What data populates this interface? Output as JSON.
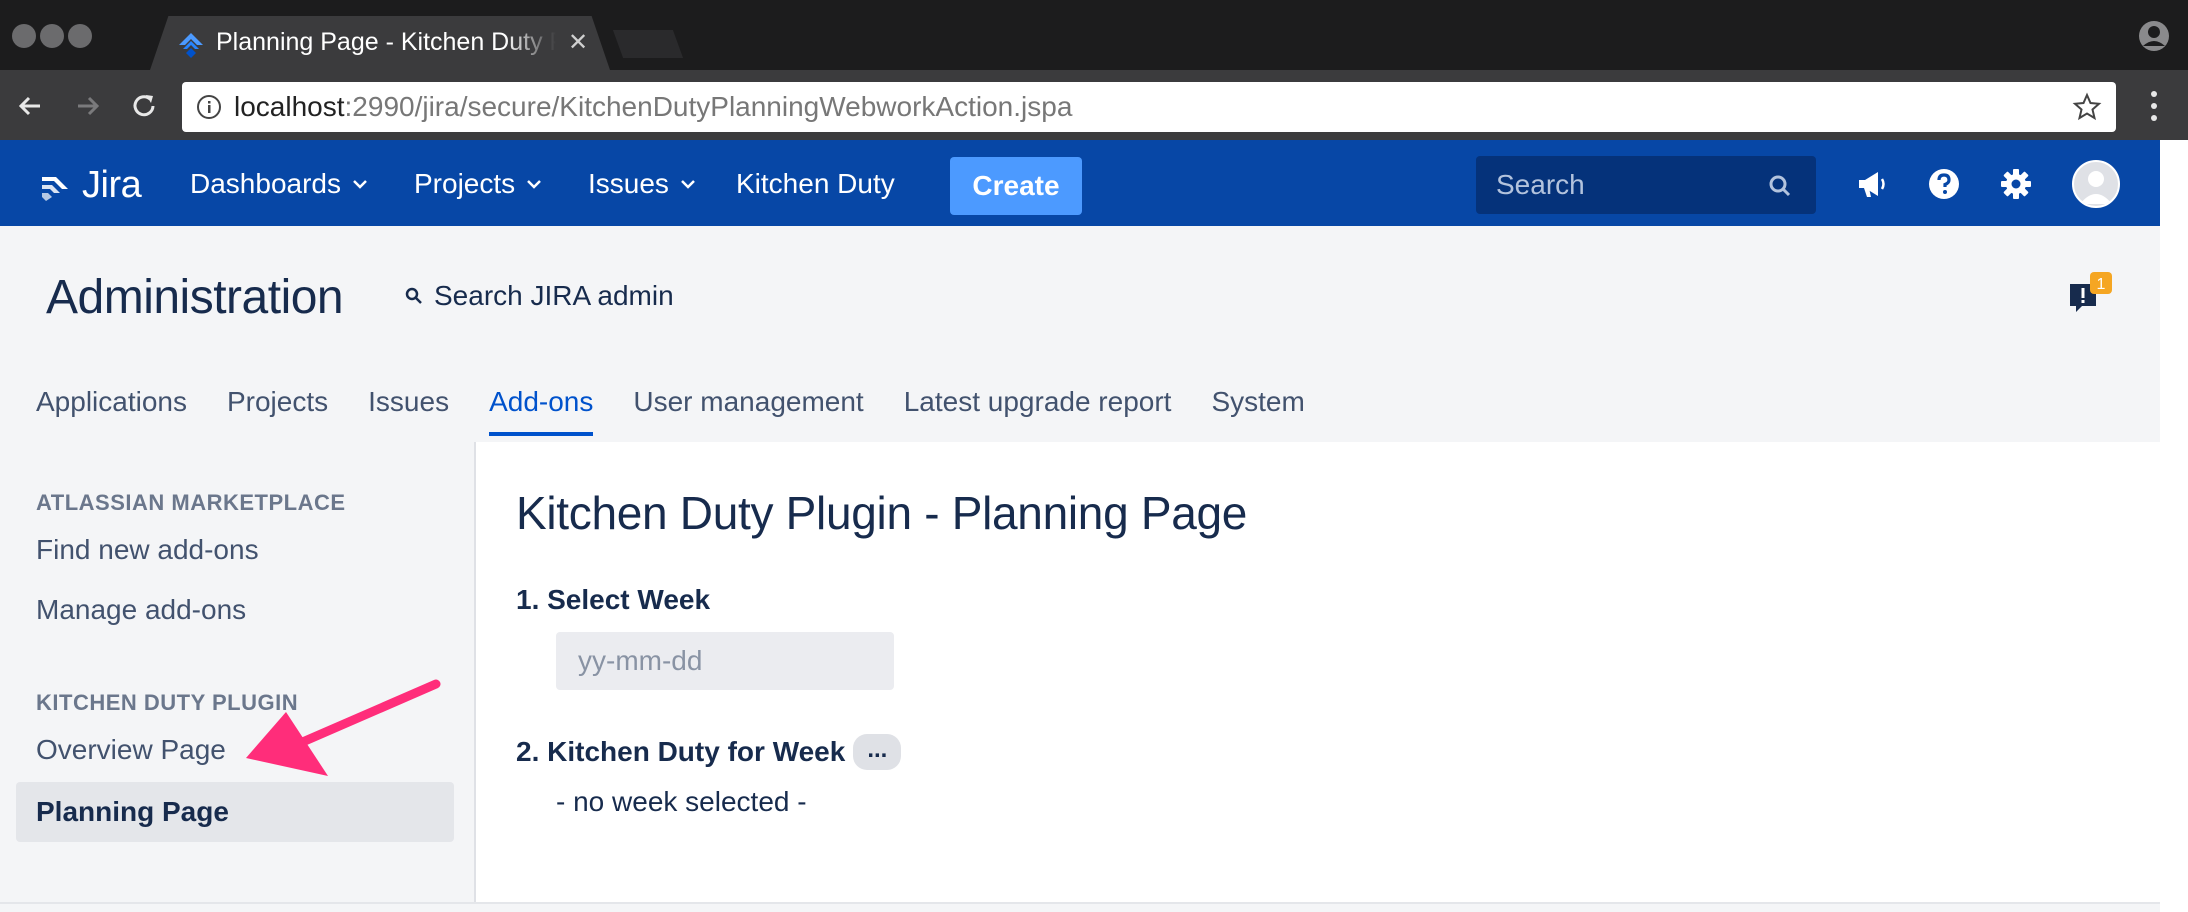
{
  "browser": {
    "tab_title": "Planning Page - Kitchen Duty Plugin",
    "url_host": "localhost",
    "url_path": ":2990/jira/secure/KitchenDutyPlanningWebworkAction.jspa"
  },
  "header": {
    "logo_text": "Jira",
    "nav": {
      "dashboards": "Dashboards",
      "projects": "Projects",
      "issues": "Issues",
      "kitchen_duty": "Kitchen Duty"
    },
    "create_label": "Create",
    "search_placeholder": "Search"
  },
  "admin": {
    "title": "Administration",
    "search_label": "Search JIRA admin",
    "notification_count": "1",
    "tabs": [
      "Applications",
      "Projects",
      "Issues",
      "Add-ons",
      "User management",
      "Latest upgrade report",
      "System"
    ],
    "active_tab": "Add-ons"
  },
  "sidebar": {
    "section1_heading": "ATLASSIAN MARKETPLACE",
    "section1_items": [
      "Find new add-ons",
      "Manage add-ons"
    ],
    "section2_heading": "KITCHEN DUTY PLUGIN",
    "section2_items": [
      "Overview Page",
      "Planning Page"
    ],
    "selected": "Planning Page"
  },
  "main": {
    "title": "Kitchen Duty Plugin - Planning Page",
    "step1_label": "1. Select Week",
    "week_placeholder": "yy-mm-dd",
    "step2_label": "2. Kitchen Duty for Week",
    "week_badge": "...",
    "no_week_text": "- no week selected -"
  },
  "colors": {
    "jira_blue": "#0747a6",
    "create_button": "#4c9aff",
    "active_tab": "#0052cc",
    "annotation_arrow": "#ff2d7a",
    "notification_badge": "#f5a623"
  },
  "icons": [
    "jira-logo-icon",
    "chevron-down-icon",
    "search-icon",
    "megaphone-icon",
    "help-icon",
    "gear-icon",
    "avatar-icon",
    "feedback-icon",
    "star-icon",
    "back-icon",
    "forward-icon",
    "reload-icon",
    "info-icon"
  ]
}
